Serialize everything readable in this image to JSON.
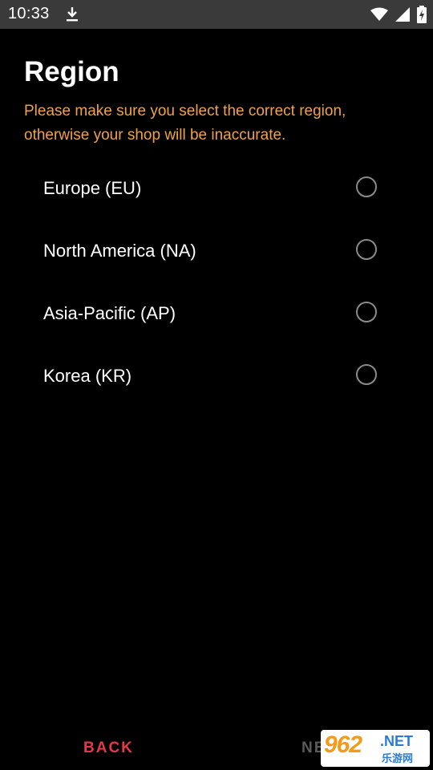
{
  "status_bar": {
    "time": "10:33",
    "icons": [
      "download-icon",
      "wifi-icon",
      "signal-icon",
      "battery-charging-icon"
    ]
  },
  "page": {
    "title": "Region",
    "subtitle": "Please make sure you select the correct region, otherwise your shop will be inaccurate."
  },
  "regions": [
    {
      "label": "Europe (EU)",
      "selected": false
    },
    {
      "label": "North America (NA)",
      "selected": false
    },
    {
      "label": "Asia-Pacific (AP)",
      "selected": false
    },
    {
      "label": "Korea (KR)",
      "selected": false
    }
  ],
  "footer": {
    "back_label": "BACK",
    "next_label": "NE"
  },
  "watermark": {
    "number": "962",
    "suffix": ".NET",
    "sub": "乐游网"
  },
  "colors": {
    "background": "#000000",
    "status_bar": "#3a3a3a",
    "subtitle": "#f0a24a",
    "back_button": "#e5374a",
    "next_button_disabled": "#5a5a5a",
    "radio_border": "#8a8a8a"
  }
}
